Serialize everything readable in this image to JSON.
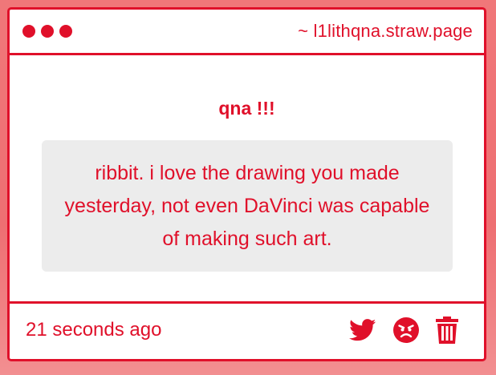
{
  "window": {
    "url": "~ l1lithqna.straw.page"
  },
  "post": {
    "title": "qna !!!",
    "message": "ribbit. i love the drawing you made yesterday, not even DaVinci was capable of making such art."
  },
  "footer": {
    "timestamp": "21 seconds ago"
  },
  "icons": {
    "share": "twitter-icon",
    "react": "angry-face-icon",
    "delete": "trash-icon"
  },
  "colors": {
    "accent": "#e0102a",
    "background": "#f07779",
    "message_bg": "#ececec"
  }
}
